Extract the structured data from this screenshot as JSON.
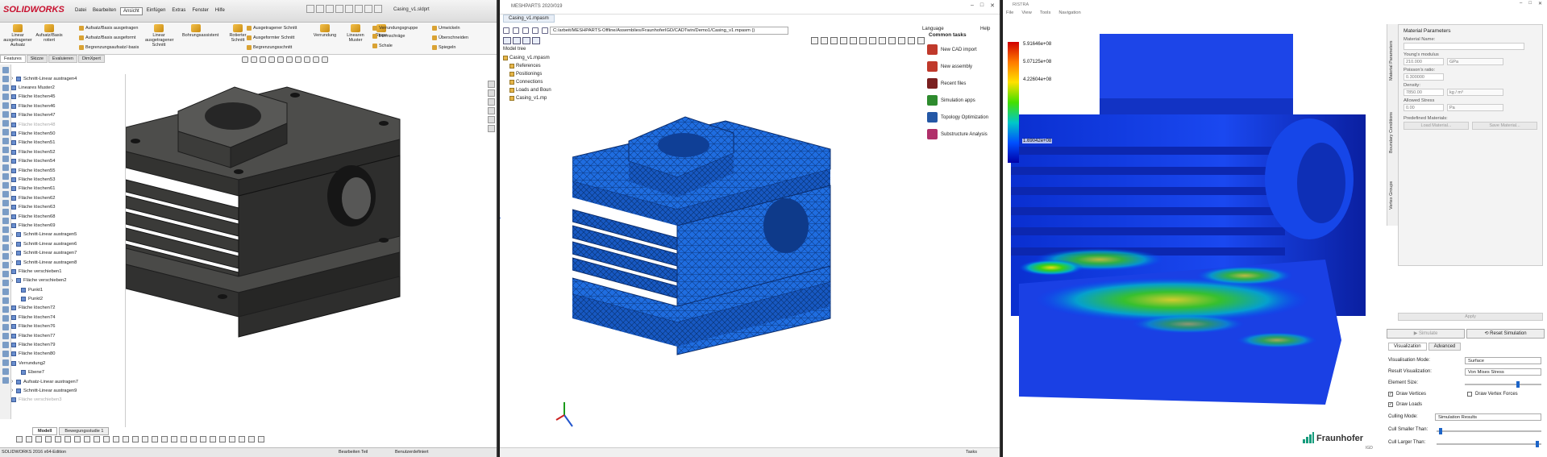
{
  "solidworks": {
    "logo": "SOLIDWORKS",
    "menu": [
      "Datei",
      "Bearbeiten",
      "Ansicht",
      "Einfügen",
      "Extras",
      "Fenster",
      "Hilfe"
    ],
    "menu_active": "Ansicht",
    "document_title": "Casing_v1.sldprt",
    "ribbon": {
      "big": [
        {
          "label": "Linear ausgetragener Aufsatz"
        },
        {
          "label": "Aufsatz/Basis rotiert"
        },
        {
          "label": "Linear ausgetragener Schnitt"
        },
        {
          "label": "Bohrungsassistent"
        },
        {
          "label": "Rotierter Schnitt"
        },
        {
          "label": "Verrundung"
        },
        {
          "label": "Linearen Muster"
        },
        {
          "label": "Rippe"
        }
      ],
      "small": [
        "Aufsatz/Basis ausgetragen",
        "Aufsatz/Basis ausgeformt",
        "Begrenzungsaufsatz/-basis",
        "Ausgetragener Schnitt",
        "Ausgeformter Schnitt",
        "Begrenzungsschnitt",
        "Verrundung",
        "Formschräge",
        "Schale",
        "Umwickeln",
        "Überschneiden",
        "Spiegeln",
        "Verrundungsgruppe"
      ]
    },
    "tabs": [
      "Features",
      "Skizze",
      "Evaluieren",
      "DimXpert"
    ],
    "tabs_active": "Features",
    "tree": [
      {
        "label": "Schnitt-Linear austragen4",
        "type": "exp"
      },
      {
        "label": "Lineares Muster2",
        "type": "item"
      },
      {
        "label": "Fläche löschen45",
        "type": "item"
      },
      {
        "label": "Fläche löschen46",
        "type": "item"
      },
      {
        "label": "Fläche löschen47",
        "type": "item"
      },
      {
        "label": "Fläche löschen48",
        "type": "dim"
      },
      {
        "label": "Fläche löschen50",
        "type": "item"
      },
      {
        "label": "Fläche löschen51",
        "type": "item"
      },
      {
        "label": "Fläche löschen52",
        "type": "item"
      },
      {
        "label": "Fläche löschen54",
        "type": "item"
      },
      {
        "label": "Fläche löschen55",
        "type": "item"
      },
      {
        "label": "Fläche löschen53",
        "type": "item"
      },
      {
        "label": "Fläche löschen61",
        "type": "item"
      },
      {
        "label": "Fläche löschen62",
        "type": "item"
      },
      {
        "label": "Fläche löschen63",
        "type": "item"
      },
      {
        "label": "Fläche löschen68",
        "type": "item"
      },
      {
        "label": "Fläche löschen69",
        "type": "item"
      },
      {
        "label": "Schnitt-Linear austragen5",
        "type": "exp"
      },
      {
        "label": "Schnitt-Linear austragen6",
        "type": "exp"
      },
      {
        "label": "Schnitt-Linear austragen7",
        "type": "exp"
      },
      {
        "label": "Schnitt-Linear austragen8",
        "type": "exp"
      },
      {
        "label": "Fläche verschieben1",
        "type": "item"
      },
      {
        "label": "Fläche verschieben2",
        "type": "exp"
      },
      {
        "label": "Punkt1",
        "type": "sub"
      },
      {
        "label": "Punkt2",
        "type": "sub"
      },
      {
        "label": "Fläche löschen72",
        "type": "item"
      },
      {
        "label": "Fläche löschen74",
        "type": "item"
      },
      {
        "label": "Fläche löschen76",
        "type": "item"
      },
      {
        "label": "Fläche löschen77",
        "type": "item"
      },
      {
        "label": "Fläche löschen79",
        "type": "item"
      },
      {
        "label": "Fläche löschen80",
        "type": "item"
      },
      {
        "label": "Verrundung2",
        "type": "item"
      },
      {
        "label": "Ebene7",
        "type": "sub"
      },
      {
        "label": "Aufsatz-Linear austragen7",
        "type": "exp"
      },
      {
        "label": "Schnitt-Linear austragen9",
        "type": "exp"
      },
      {
        "label": "Fläche verschieben3",
        "type": "dim"
      }
    ],
    "bottom_tabs": [
      "Modell",
      "Bewegungsstudie 1"
    ],
    "bottom_tabs_active": "Modell",
    "status": {
      "left": "SOLIDWORKS 2016 x64-Edition",
      "mid": "Bearbeiten Teil",
      "right": "Benutzerdefiniert"
    }
  },
  "meshparts": {
    "app_title": "MESHPARTS 2020/019",
    "doc_tab": "Casing_v1.mpasm",
    "path": "C:/arbeit/MESHPARTS-Offline/Assemblies/FraunhoferIGD/CADTwin/Demo1/Casing_v1.mpasm ()",
    "language": "Language",
    "help": "Help",
    "model_tree_title": "Model tree",
    "tree": [
      {
        "label": "Casing_v1.mpasm",
        "level": "l0"
      },
      {
        "label": "References",
        "level": "l1"
      },
      {
        "label": "Positionings",
        "level": "l1"
      },
      {
        "label": "Connections",
        "level": "l1"
      },
      {
        "label": "Loads and Boun",
        "level": "l1"
      },
      {
        "label": "Casing_v1.mp",
        "level": "l1"
      }
    ],
    "common_tasks_title": "Common tasks",
    "common_tasks": [
      {
        "label": "New CAD import",
        "color": "#c0392b"
      },
      {
        "label": "New assembly",
        "color": "#c0392b"
      },
      {
        "label": "Recent files",
        "color": "#7a1f1f"
      },
      {
        "label": "Simulation apps",
        "color": "#2e8b2e"
      },
      {
        "label": "Topology Optimization",
        "color": "#2458a6"
      },
      {
        "label": "Substructure Analysis",
        "color": "#b0306a"
      }
    ],
    "status_right": "Tasks",
    "mesh_color": "#1e6fe0"
  },
  "simulation": {
    "app_title": "RISTRA",
    "menu": [
      "File",
      "View",
      "Tools",
      "Navigation"
    ],
    "legend_labels": [
      "5.91646e+08",
      "5.07125e+08",
      "4.22604e+08",
      "1.69042e+08"
    ],
    "vtabs": [
      "Material Parameters",
      "Boundary Conditions",
      "Vertex Groups"
    ],
    "panel_title": "Material Parameters",
    "material_name_label": "Material Name:",
    "youngs_label": "Young's modulus",
    "youngs_value": "210.000",
    "youngs_unit": "GPa",
    "poisson_label": "Poisson's ratio:",
    "poisson_value": "0.300000",
    "density_label": "Density:",
    "density_value": "7850.00",
    "density_unit": "kg / m³",
    "stress_label": "Allowed Stress",
    "stress_value": "0.00",
    "stress_unit": "Pa",
    "predefined_label": "Predefined Materials:",
    "load_btn": "Load Material...",
    "save_btn": "Save Material...",
    "apply_btn": "Apply",
    "simulate_btn": "Simulate",
    "reset_btn": "Reset Simulation",
    "vis_tabs": [
      "Visualization",
      "Advanced"
    ],
    "vis_tabs_active": "Visualization",
    "vis_mode_label": "Visualisation Mode:",
    "vis_mode_value": "Surface",
    "result_label": "Result Visualization:",
    "result_value": "Von Mises Stress",
    "element_size_label": "Element Size:",
    "element_size_level": 0.7,
    "draw_vertices": "Draw Vertices",
    "draw_vertex_forces": "Draw Vertex Forces",
    "draw_loads": "Draw Loads",
    "culling_label": "Culling Mode:",
    "culling_value": "Simulation Results",
    "cull_smaller_label": "Cull Smaller Than:",
    "cull_smaller_level": 0.02,
    "cull_larger_label": "Cull Larger Than:",
    "cull_larger_level": 0.98,
    "brand": "Fraunhofer",
    "brand_sub": "IGD"
  }
}
